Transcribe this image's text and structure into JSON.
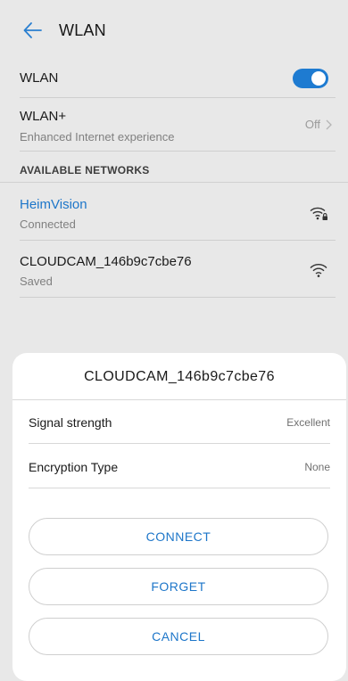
{
  "header": {
    "title": "WLAN",
    "back_icon": "arrow-left-icon"
  },
  "settings": {
    "wlan": {
      "label": "WLAN",
      "toggle_on": true
    },
    "wlan_plus": {
      "label": "WLAN+",
      "subtitle": "Enhanced Internet experience",
      "status": "Off"
    }
  },
  "networks_section": {
    "header": "AVAILABLE NETWORKS",
    "items": [
      {
        "name": "HeimVision",
        "status": "Connected",
        "icon": "wifi-lock-icon"
      },
      {
        "name": "CLOUDCAM_146b9c7cbe76",
        "status": "Saved",
        "icon": "wifi-icon"
      }
    ]
  },
  "dialog": {
    "title": "CLOUDCAM_146b9c7cbe76",
    "rows": [
      {
        "label": "Signal strength",
        "value": "Excellent"
      },
      {
        "label": "Encryption Type",
        "value": "None"
      }
    ],
    "buttons": {
      "connect": "CONNECT",
      "forget": "FORGET",
      "cancel": "CANCEL"
    }
  },
  "colors": {
    "accent": "#1e7bd1",
    "overlay_background": "#e8e8e8",
    "dialog_background": "#ffffff"
  }
}
